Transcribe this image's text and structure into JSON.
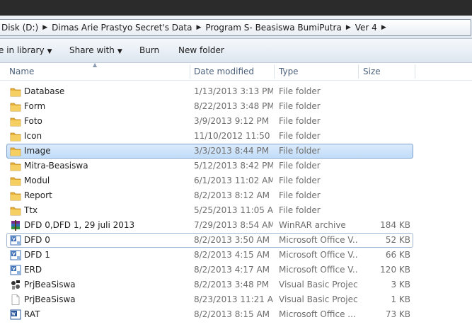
{
  "address": {
    "crumbs": [
      "Disk (D:)",
      "Dimas Arie Prastyo Secret's Data",
      "Program S- Beasiswa BumiPutra",
      "Ver 4"
    ]
  },
  "toolbar": {
    "include_label": "e in library",
    "share_label": "Share with",
    "burn_label": "Burn",
    "new_folder_label": "New folder"
  },
  "columns": {
    "name": "Name",
    "date": "Date modified",
    "type": "Type",
    "size": "Size"
  },
  "files": [
    {
      "name": "Database",
      "date": "1/13/2013 3:13 PM",
      "type": "File folder",
      "size": "",
      "icon": "folder-icon",
      "state": ""
    },
    {
      "name": "Form",
      "date": "8/22/2013 3:48 PM",
      "type": "File folder",
      "size": "",
      "icon": "folder-icon",
      "state": ""
    },
    {
      "name": "Foto",
      "date": "3/9/2013 9:12 PM",
      "type": "File folder",
      "size": "",
      "icon": "folder-icon",
      "state": ""
    },
    {
      "name": "Icon",
      "date": "11/10/2012 11:50 ...",
      "type": "File folder",
      "size": "",
      "icon": "folder-icon",
      "state": ""
    },
    {
      "name": "Image",
      "date": "3/3/2013 8:44 PM",
      "type": "File folder",
      "size": "",
      "icon": "folder-icon",
      "state": "selected"
    },
    {
      "name": "Mitra-Beasiswa",
      "date": "5/12/2013 8:42 PM",
      "type": "File folder",
      "size": "",
      "icon": "folder-icon",
      "state": ""
    },
    {
      "name": "Modul",
      "date": "6/1/2013 11:02 AM",
      "type": "File folder",
      "size": "",
      "icon": "folder-icon",
      "state": ""
    },
    {
      "name": "Report",
      "date": "8/2/2013 8:12 AM",
      "type": "File folder",
      "size": "",
      "icon": "folder-icon",
      "state": ""
    },
    {
      "name": "Ttx",
      "date": "5/25/2013 11:05 AM",
      "type": "File folder",
      "size": "",
      "icon": "folder-icon",
      "state": ""
    },
    {
      "name": "DFD 0,DFD 1, 29 juli 2013",
      "date": "7/29/2013 8:54 AM",
      "type": "WinRAR archive",
      "size": "184 KB",
      "icon": "winrar-icon",
      "state": ""
    },
    {
      "name": "DFD 0",
      "date": "8/2/2013 3:50 AM",
      "type": "Microsoft Office V...",
      "size": "52 KB",
      "icon": "visio-icon",
      "state": "focused"
    },
    {
      "name": "DFD 1",
      "date": "8/2/2013 4:15 AM",
      "type": "Microsoft Office V...",
      "size": "66 KB",
      "icon": "visio-icon",
      "state": ""
    },
    {
      "name": "ERD",
      "date": "8/2/2013 4:17 AM",
      "type": "Microsoft Office V...",
      "size": "120 KB",
      "icon": "visio-icon",
      "state": ""
    },
    {
      "name": "PrjBeaSiswa",
      "date": "8/2/2013 3:48 PM",
      "type": "Visual Basic Project",
      "size": "3 KB",
      "icon": "vb-project-icon",
      "state": ""
    },
    {
      "name": "PrjBeaSiswa",
      "date": "8/23/2013 11:21 AM",
      "type": "Visual Basic Projec...",
      "size": "1 KB",
      "icon": "document-icon",
      "state": ""
    },
    {
      "name": "RAT",
      "date": "8/2/2013 8:15 AM",
      "type": "Microsoft Office ...",
      "size": "73 KB",
      "icon": "word-icon",
      "state": ""
    }
  ]
}
